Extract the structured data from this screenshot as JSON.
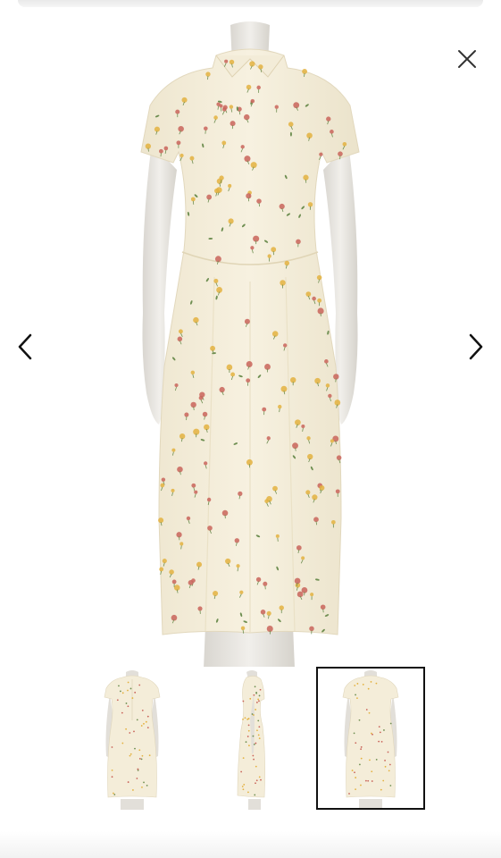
{
  "viewer": {
    "title": "",
    "current_index": 3,
    "total_images": 3
  },
  "controls": {
    "close_icon": "close-icon",
    "prev_icon": "chevron-left-icon",
    "next_icon": "chevron-right-icon"
  },
  "thumbnails": [
    {
      "view": "front",
      "selected": false
    },
    {
      "view": "side",
      "selected": false
    },
    {
      "view": "back",
      "selected": true
    }
  ],
  "colors": {
    "dress_base": "#f5eedb",
    "flower_red": "#c9645a",
    "flower_yellow": "#e3b13f",
    "leaf_green": "#6f8f52",
    "mannequin": "#e6e3dd",
    "selected_border": "#111111"
  }
}
